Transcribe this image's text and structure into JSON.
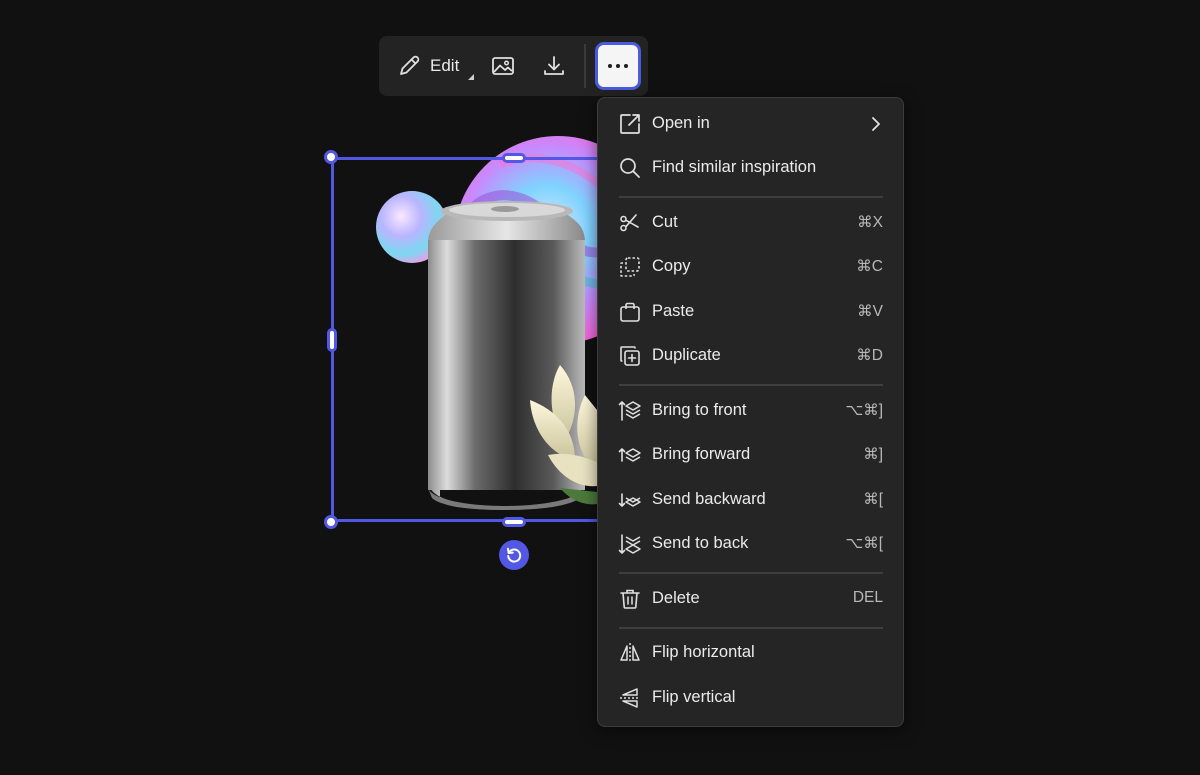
{
  "toolbar": {
    "edit_label": "Edit",
    "edit_icon": "pencil-icon",
    "image_icon": "image-icon",
    "download_icon": "download-icon",
    "more_icon": "more-icon"
  },
  "selection": {
    "rotate_icon": "rotate-icon"
  },
  "menu": {
    "items": [
      {
        "label": "Open in",
        "shortcut": "",
        "icon": "open-external-icon",
        "submenu": true
      },
      {
        "label": "Find similar inspiration",
        "shortcut": "",
        "icon": "search-icon"
      },
      {
        "label": "Cut",
        "shortcut": "⌘X",
        "icon": "scissors-icon"
      },
      {
        "label": "Copy",
        "shortcut": "⌘C",
        "icon": "copy-icon"
      },
      {
        "label": "Paste",
        "shortcut": "⌘V",
        "icon": "clipboard-icon"
      },
      {
        "label": "Duplicate",
        "shortcut": "⌘D",
        "icon": "duplicate-icon"
      },
      {
        "label": "Bring to front",
        "shortcut": "⌥⌘]",
        "icon": "bring-to-front-icon"
      },
      {
        "label": "Bring forward",
        "shortcut": "⌘]",
        "icon": "bring-forward-icon"
      },
      {
        "label": "Send backward",
        "shortcut": "⌘[",
        "icon": "send-backward-icon"
      },
      {
        "label": "Send to back",
        "shortcut": "⌥⌘[",
        "icon": "send-to-back-icon"
      },
      {
        "label": "Delete",
        "shortcut": "DEL",
        "icon": "trash-icon"
      },
      {
        "label": "Flip horizontal",
        "shortcut": "",
        "icon": "flip-horizontal-icon"
      },
      {
        "label": "Flip vertical",
        "shortcut": "",
        "icon": "flip-vertical-icon"
      }
    ]
  }
}
